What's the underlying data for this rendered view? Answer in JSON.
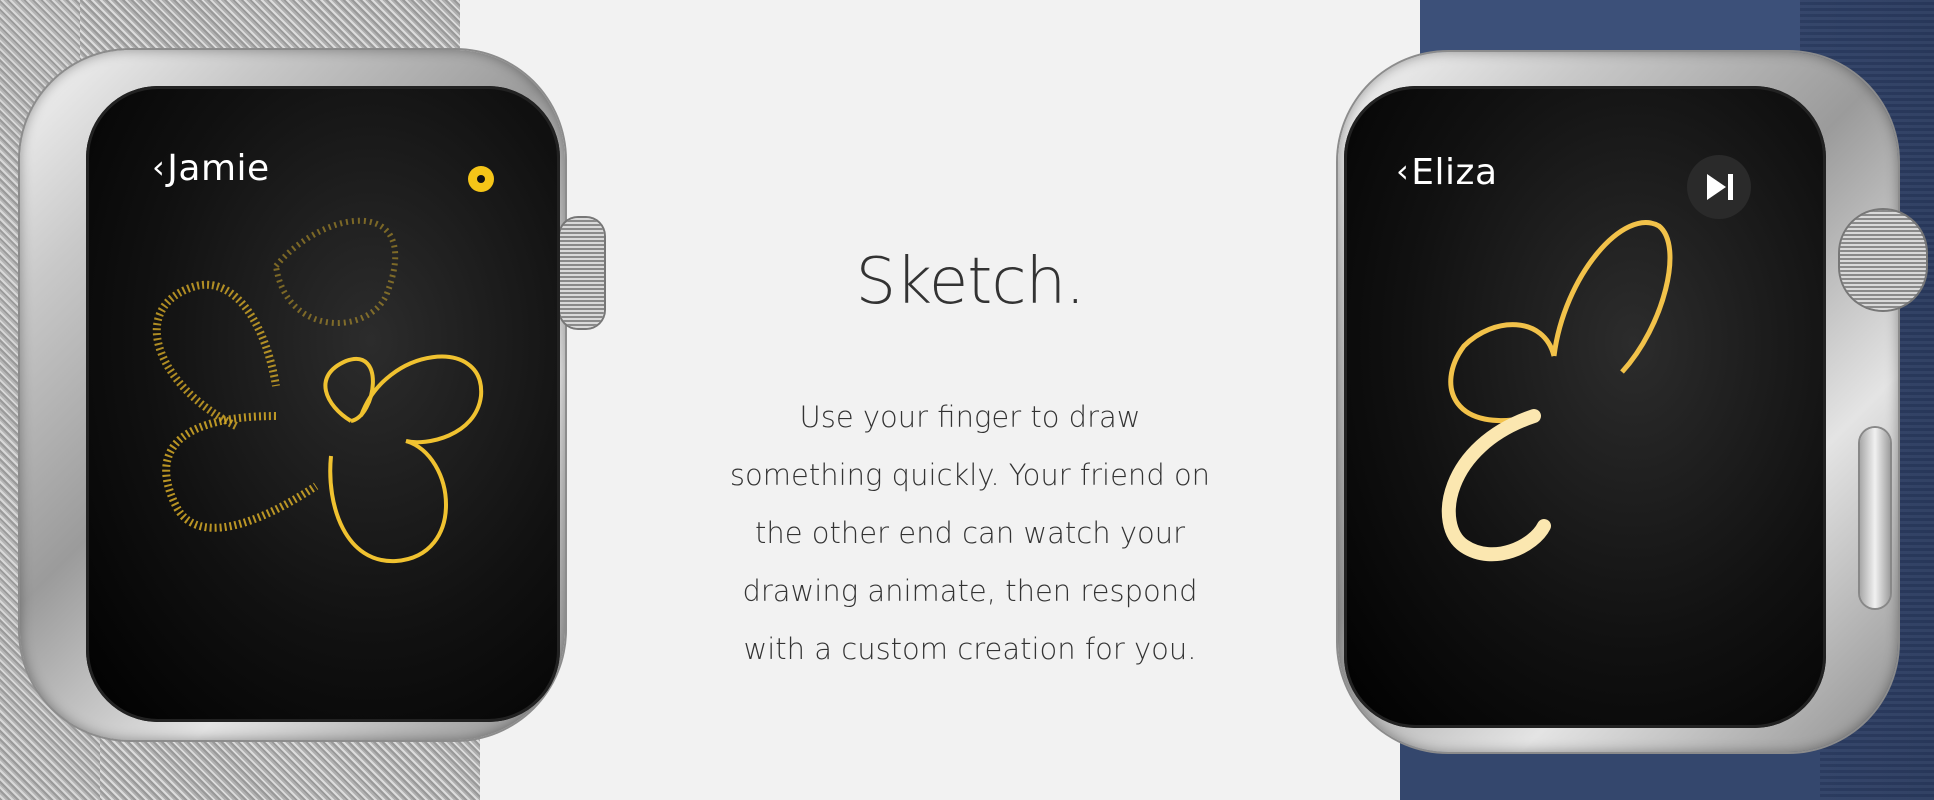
{
  "hero": {
    "title": "Sketch.",
    "description_lines": [
      "Use your finger to draw",
      "something quickly. Your friend on",
      "the other end can watch your",
      "drawing animate, then respond",
      "with a custom creation for you."
    ]
  },
  "watches": {
    "left": {
      "contact_name": "Jamie",
      "back_icon": "chevron-left-icon",
      "status_icon": "color-dot-icon",
      "accent_color": "#f5c518",
      "drawing": "flower-sketch"
    },
    "right": {
      "contact_name": "Eliza",
      "back_icon": "chevron-left-icon",
      "action_icon": "skip-forward-icon",
      "accent_color": "#f7c53a",
      "drawing": "heart-sketch"
    }
  }
}
